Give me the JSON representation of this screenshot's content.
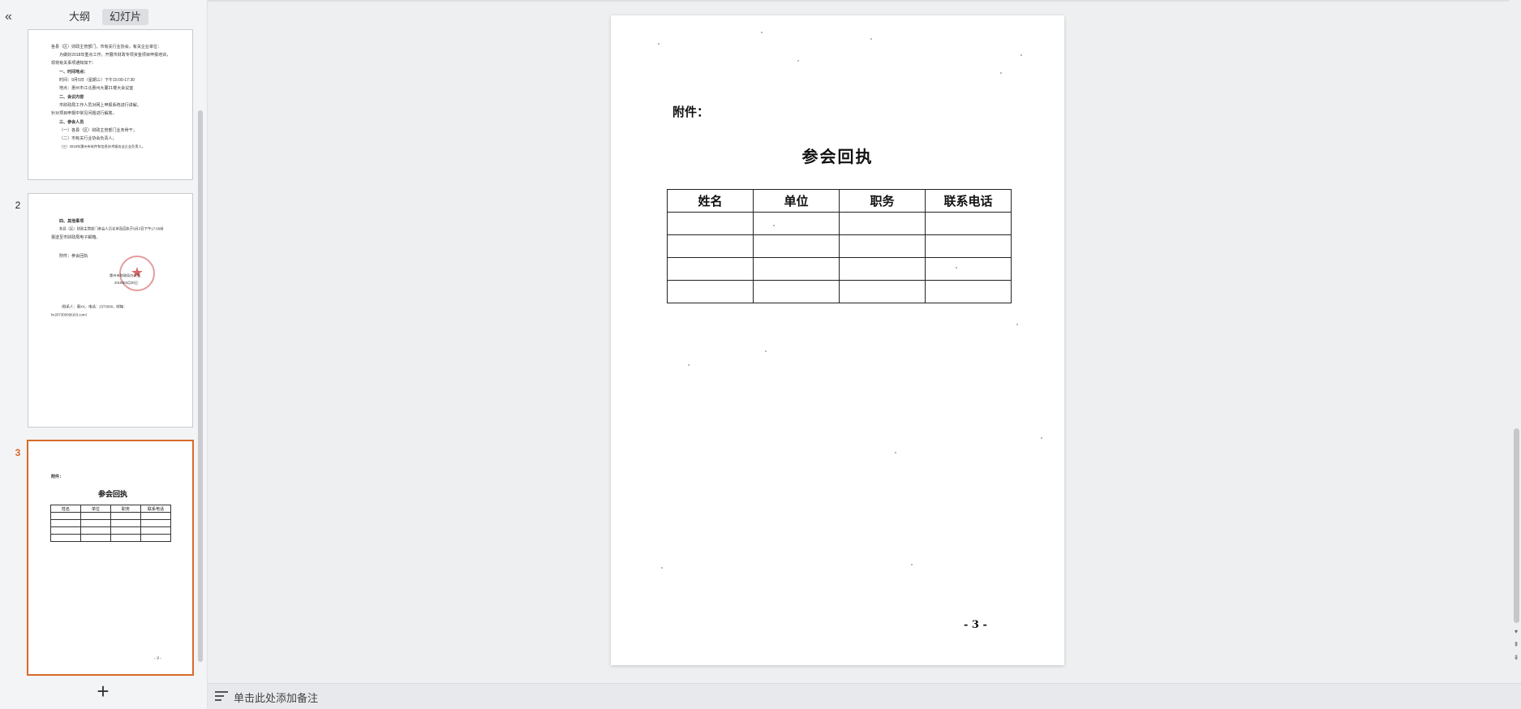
{
  "left_panel": {
    "collapse_icon": "double-chevron-left-icon",
    "tabs": [
      {
        "label": "大纲",
        "active": false
      },
      {
        "label": "幻灯片",
        "active": true
      }
    ],
    "slides": [
      {
        "number": "1",
        "mini_lines": [
          "各县（区）财政主管部门，市有关行业协会，有关企业单位：",
          "为做好2018年重点工作，开展市财政专项资金项目申报培训，",
          "现将有关事项通知如下：",
          "一、时间地点：",
          "时间：9月5日（星期三）下午15:00-17:30",
          "地点：惠州市江北惠州大厦21楼大会议室",
          "二、会议内容",
          "市财政局工作人员对网上申报系统进行讲解，",
          "针对项目申报中常见问题进行解答。",
          "三、参会人员",
          "（一）各县（区）财政主管部门业务骨干；",
          "（二）市有关行业协会负责人；",
          "（三）2018年惠州市软件和信息技术服务业企业负责人。"
        ]
      },
      {
        "number": "2",
        "mini_lines": [
          "四、其他事项",
          "各县（区）财政主管部门参会人员名单及回执于9月3日下午17:00前",
          "报送至市财政局电子邮箱。",
          "附件：参会回执",
          "（联系人：惠XX，电话：2373000，邮箱：",
          "hz2073000@163.com）"
        ],
        "seal_text": "惠州市财政局办公室",
        "seal_date": "2018年8月30日"
      },
      {
        "number": "3",
        "active": true,
        "attach_label": "附件：",
        "title": "参会回执",
        "headers": [
          "姓名",
          "单位",
          "职务",
          "联系电话"
        ],
        "page_label": "- 3 -"
      }
    ],
    "add_icon": "plus-icon"
  },
  "document": {
    "attach_label": "附件：",
    "title": "参会回执",
    "table_headers": [
      "姓名",
      "单位",
      "职务",
      "联系电话"
    ],
    "table_empty_rows": 4,
    "page_number": "- 3 -"
  },
  "notes": {
    "icon": "notes-list-icon",
    "placeholder": "单击此处添加备注"
  },
  "scrollbar": {
    "up_icon": "scroll-up-icon",
    "down_icon": "scroll-down-icon",
    "prev_page_icon": "prev-page-icon",
    "next_page_icon": "next-page-icon"
  }
}
